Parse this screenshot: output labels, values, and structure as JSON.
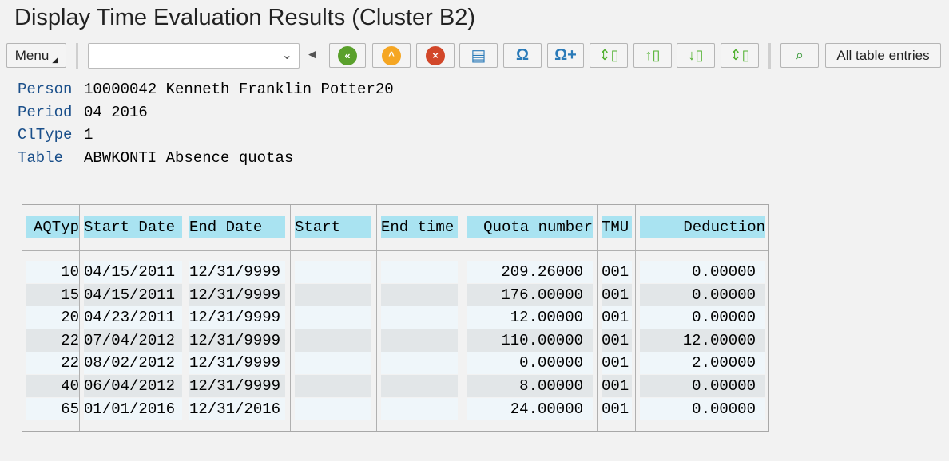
{
  "title": "Display Time Evaluation Results (Cluster B2)",
  "toolbar": {
    "menu_label": "Menu",
    "combo_value": "",
    "all_entries_label": "All table entries",
    "icons": [
      "back-icon",
      "exit-icon",
      "cancel-icon",
      "print-icon",
      "find-icon",
      "find-next-icon",
      "first-page-icon",
      "previous-page-icon",
      "next-page-icon",
      "last-page-icon",
      "details-icon"
    ]
  },
  "header": [
    {
      "label": "Person",
      "value": "10000042 Kenneth Franklin Potter20"
    },
    {
      "label": "Period",
      "value": "04 2016"
    },
    {
      "label": "ClType",
      "value": "1"
    },
    {
      "label": "Table",
      "value": "ABWKONTI Absence quotas"
    }
  ],
  "table": {
    "columns": [
      "AQTyp",
      "Start Date",
      "End Date",
      "Start",
      "End time",
      "Quota number",
      "TMU",
      "Deduction"
    ],
    "rows": [
      [
        "10",
        "04/15/2011",
        "12/31/9999",
        "",
        "",
        "209.26000",
        "001",
        "0.00000"
      ],
      [
        "15",
        "04/15/2011",
        "12/31/9999",
        "",
        "",
        "176.00000",
        "001",
        "0.00000"
      ],
      [
        "20",
        "04/23/2011",
        "12/31/9999",
        "",
        "",
        "12.00000",
        "001",
        "0.00000"
      ],
      [
        "22",
        "07/04/2012",
        "12/31/9999",
        "",
        "",
        "110.00000",
        "001",
        "12.00000"
      ],
      [
        "22",
        "08/02/2012",
        "12/31/9999",
        "",
        "",
        "0.00000",
        "001",
        "2.00000"
      ],
      [
        "40",
        "06/04/2012",
        "12/31/9999",
        "",
        "",
        "8.00000",
        "001",
        "0.00000"
      ],
      [
        "65",
        "01/01/2016",
        "12/31/2016",
        "",
        "",
        "24.00000",
        "001",
        "0.00000"
      ]
    ]
  }
}
